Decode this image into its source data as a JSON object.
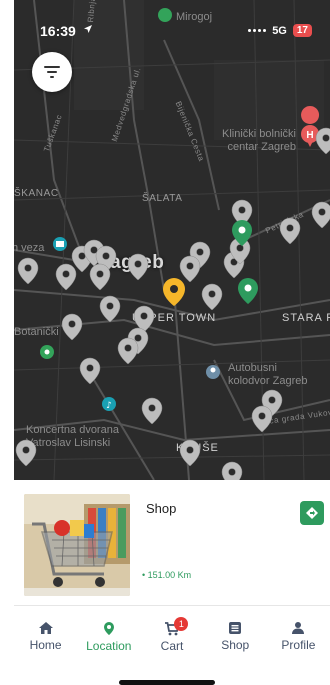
{
  "status_bar": {
    "time": "16:39",
    "network": "5G",
    "battery": "17"
  },
  "map": {
    "labels": {
      "mirogoj": "Mirogoj",
      "hospital": "Klinički bolnički\ncentar Zagreb",
      "skanac": "ŠKANAC",
      "salata": "ŠALATA",
      "veza": "h veza",
      "zagreb": "Zagreb",
      "botanicki": "Botanički",
      "upper_town": "UPPER TOWN",
      "stara_pe": "STARA PE",
      "bus_station": "Autobusni\nkolodvor Zagreb",
      "concert_hall": "Koncertna dvorana\nVatroslav Lisinski",
      "kruse": "KRUŠE",
      "street_bijenicka": "Bijenička Cesta",
      "street_medvedgradska": "Medvedgradska ul.",
      "street_tuskanac": "Tuškanac",
      "street_vukovara": "Ulica grada Vukovara",
      "street_petrinjska": "Petrinjska",
      "street_ribnjak": "Ribnjak"
    }
  },
  "card": {
    "title": "Shop",
    "distance": "151.00 Km"
  },
  "nav": {
    "home": "Home",
    "location": "Location",
    "cart": "Cart",
    "cart_count": "1",
    "shop": "Shop",
    "profile": "Profile"
  },
  "colors": {
    "accent": "#2e9b5e",
    "marker_gray": "#bdbdbd",
    "marker_selected": "#f5b62a",
    "badge_red": "#e53935",
    "map_bg": "#2b2b2b"
  }
}
